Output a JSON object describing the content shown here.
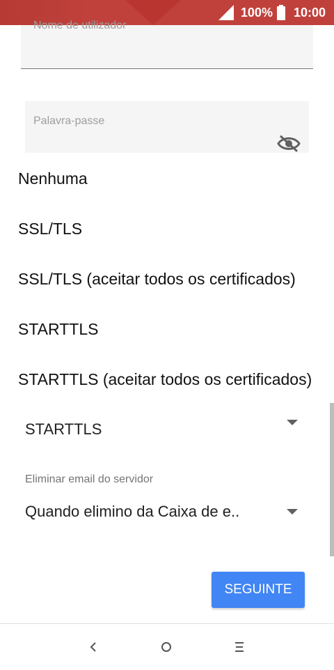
{
  "status_bar": {
    "battery_text": "100%",
    "time": "10:00",
    "icons": [
      "signal-icon",
      "battery-icon"
    ]
  },
  "form": {
    "username_placeholder": "Nome de utilizador",
    "password_placeholder": "Palavra-passe",
    "password_toggle_icon": "eye-off-icon"
  },
  "security_menu": {
    "options": [
      "Nenhuma",
      "SSL/TLS",
      "SSL/TLS (aceitar todos os certificados)",
      "STARTTLS",
      "STARTTLS (aceitar todos os certificados)"
    ],
    "selected_value": "STARTTLS"
  },
  "delete_setting": {
    "label": "Eliminar email do servidor",
    "selected_value": "Quando elimino da Caixa de e.."
  },
  "actions": {
    "next_label": "SEGUINTE"
  },
  "nav_bar": {
    "icons": [
      "back-icon",
      "home-icon",
      "menu-icon"
    ]
  },
  "colors": {
    "status_bar": "#c0413c",
    "accent_button": "#4285f4"
  }
}
